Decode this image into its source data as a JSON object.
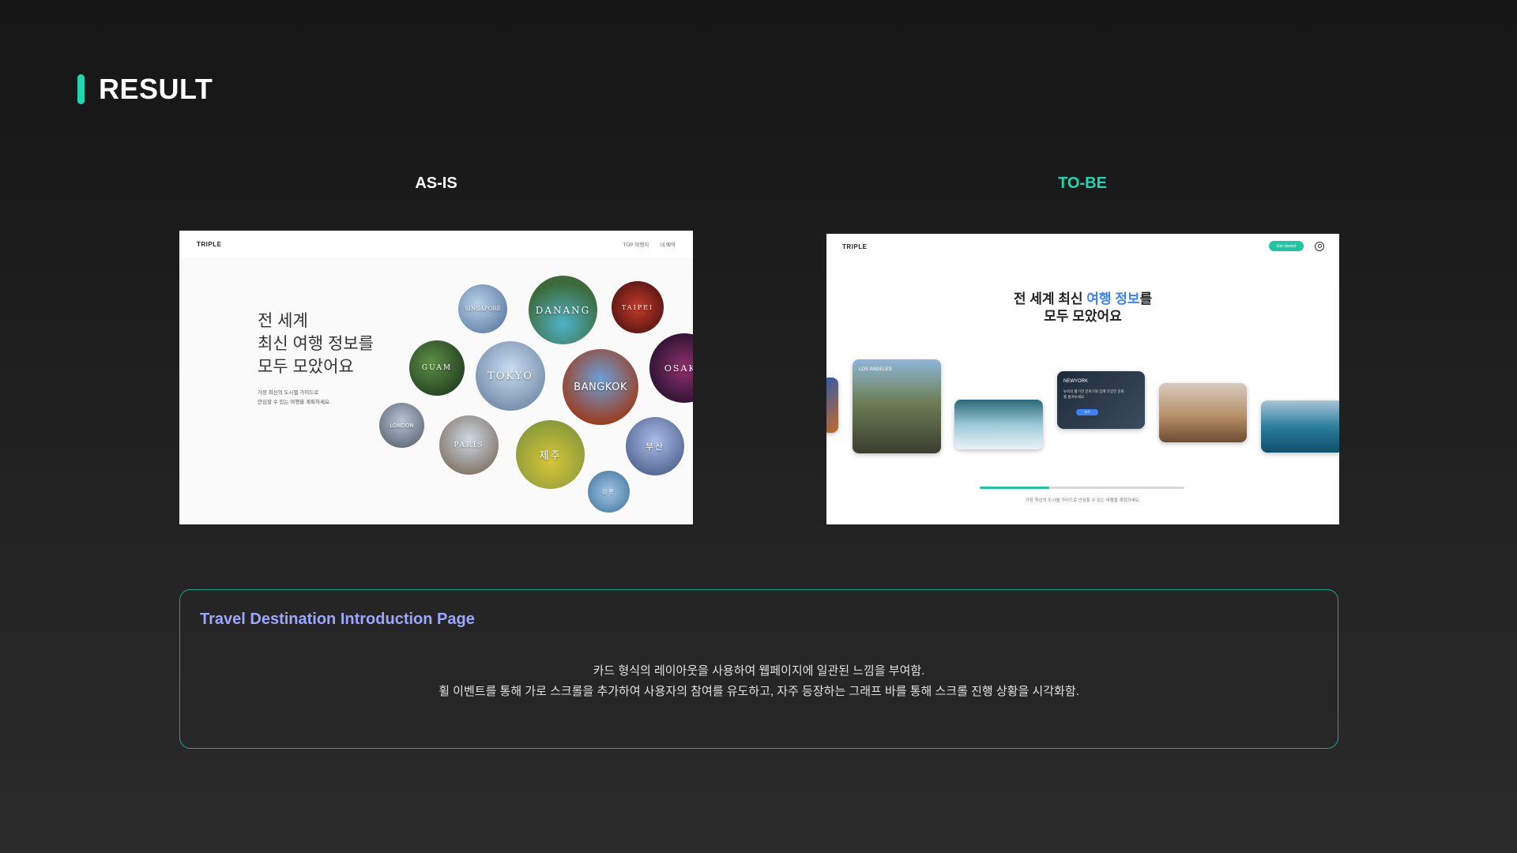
{
  "header": {
    "title": "RESULT"
  },
  "asis": {
    "label": "AS-IS",
    "logo": "TRIPLE",
    "nav": [
      "TOP 여행지",
      "내 예약"
    ],
    "heading": [
      "전 세계",
      "최신 여행 정보를",
      "모두 모았어요"
    ],
    "sub": [
      "가장 최신의 도시별 가이드로",
      "안심할 수 있는 여행을 계획하세요."
    ],
    "bubbles": [
      "SINGAPORE",
      "DANANG",
      "TAIPEI",
      "GUAM",
      "TOKYO",
      "BANGKOK",
      "OSAKA",
      "LONDON",
      "PARIS",
      "제주",
      "부산",
      "강릉"
    ]
  },
  "tobe": {
    "label": "TO-BE",
    "logo": "TRIPLE",
    "cta": "Get started",
    "heading_part1": "전 세계 최신 ",
    "heading_accent": "여행 정보",
    "heading_part2": "를",
    "heading_line2": "모두 모았어요",
    "cards": {
      "la_label": "LOS ANGELES",
      "newyork_label": "NEWYORK",
      "newyork_text": "뉴욕의 활기찬 분위기와 함께 다양한 문화를 즐겨보세요",
      "newyork_btn": "보기"
    },
    "caption": "가장 최신의 도시별 가이드로 안심할 수 있는 여행을 계획하세요.",
    "progress": 0.34
  },
  "description": {
    "title": "Travel Destination Introduction Page",
    "line1": "카드 형식의 레이아웃을 사용하여 웹페이지에 일관된 느낌을 부여함.",
    "line2": "휠 이벤트를 통해 가로 스크롤을 추가하여 사용자의 참여를 유도하고, 자주 등장하는 그래프 바를 통해 스크롤 진행 상황을 시각화함."
  },
  "colors": {
    "accent": "#1ed7b0",
    "title_blue": "#9aa8ff",
    "heading_blue": "#3b82f6"
  }
}
